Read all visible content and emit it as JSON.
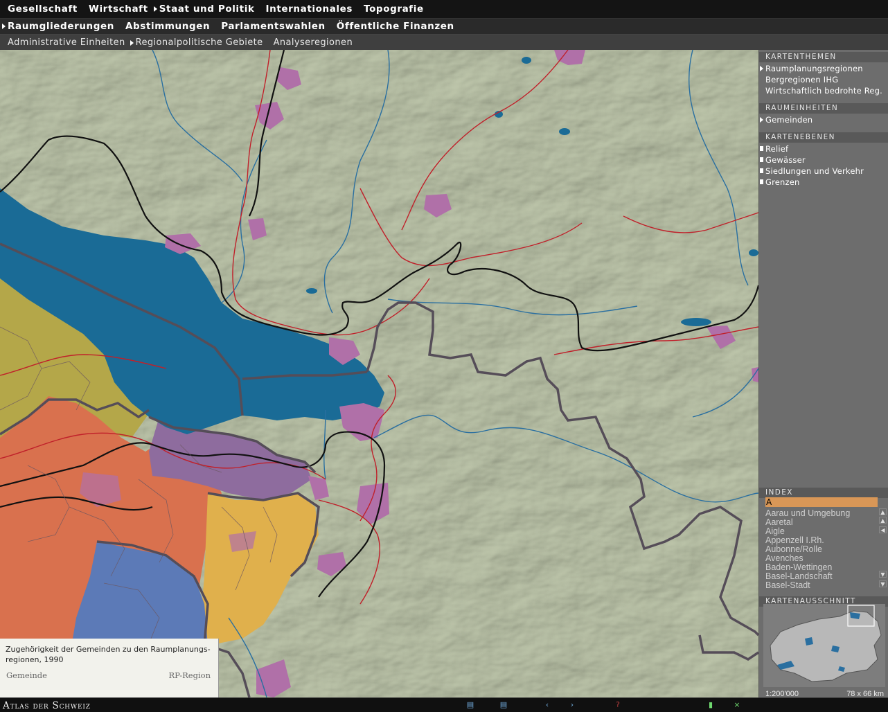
{
  "nav": {
    "primary": [
      {
        "label": "Gesellschaft",
        "active": false
      },
      {
        "label": "Wirtschaft",
        "active": false
      },
      {
        "label": "Staat und Politik",
        "active": true
      },
      {
        "label": "Internationales",
        "active": false
      },
      {
        "label": "Topografie",
        "active": false
      }
    ],
    "secondary": [
      {
        "label": "Raumgliederungen",
        "active": true
      },
      {
        "label": "Abstimmungen",
        "active": false
      },
      {
        "label": "Parlamentswahlen",
        "active": false
      },
      {
        "label": "Öffentliche Finanzen",
        "active": false
      }
    ],
    "tertiary": [
      {
        "label": "Administrative Einheiten",
        "active": false
      },
      {
        "label": "Regionalpolitische Gebiete",
        "active": true
      },
      {
        "label": "Analyseregionen",
        "active": false
      }
    ]
  },
  "side": {
    "kartenthemen": {
      "heading": "KARTENTHEMEN",
      "items": [
        "Raumplanungsregionen",
        "Bergregionen IHG",
        "Wirtschaftlich bedrohte Reg."
      ]
    },
    "raumeinheiten": {
      "heading": "RAUMEINHEITEN",
      "items": [
        "Gemeinden"
      ]
    },
    "kartenebenen": {
      "heading": "KARTENEBENEN",
      "items": [
        "Relief",
        "Gewässer",
        "Siedlungen und Verkehr",
        "Grenzen"
      ]
    },
    "index": {
      "heading": "INDEX",
      "input_value": "A",
      "items": [
        "Aarau und Umgebung",
        "Aaretal",
        "Aigle",
        "Appenzell I.Rh.",
        "Aubonne/Rolle",
        "Avenches",
        "Baden-Wettingen",
        "Basel-Landschaft",
        "Basel-Stadt"
      ]
    },
    "kartenausschnitt": {
      "heading": "KARTENAUSSCHNITT",
      "scale": "1:200'000",
      "dims": "78 x 66 km"
    }
  },
  "legend": {
    "title": "Zugehörigkeit der Gemeinden zu den Raumplanungs-regionen, 1990",
    "left": "Gemeinde",
    "right": "RP-Region"
  },
  "footer": {
    "brand": "Atlas der Schweiz"
  },
  "colors": {
    "lake": "#1a6b96",
    "terrain": "#b6bfa3",
    "settlement": "#b070a8",
    "border": "#554d58",
    "road": "#c0202a",
    "rail": "#111111",
    "river": "#2a6fa0"
  }
}
